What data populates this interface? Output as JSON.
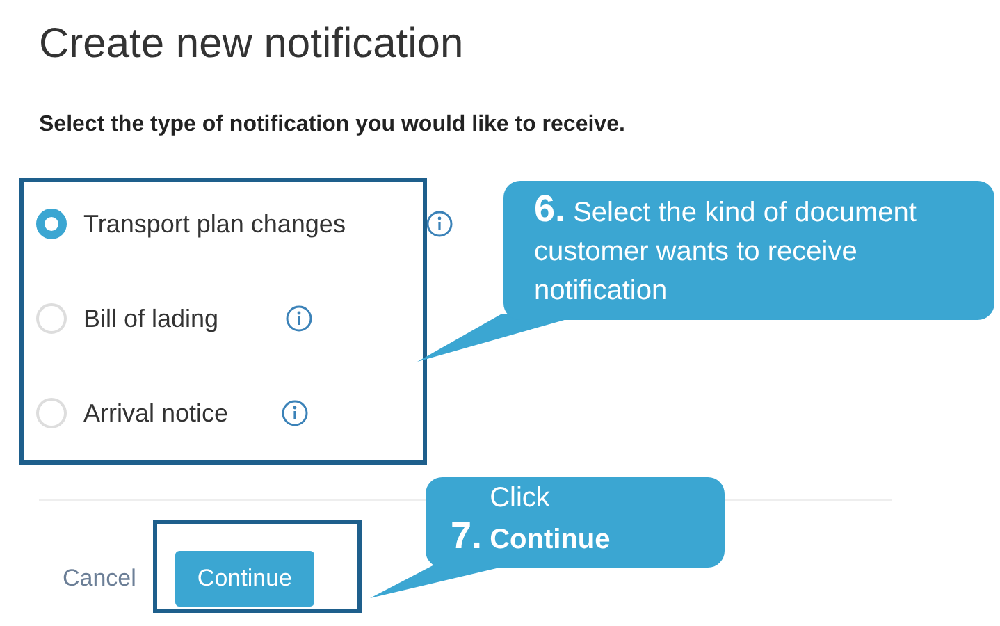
{
  "title": "Create new notification",
  "prompt": "Select the type of notification you would like to receive.",
  "options": [
    {
      "label": "Transport plan changes",
      "selected": true
    },
    {
      "label": "Bill of lading",
      "selected": false
    },
    {
      "label": "Arrival notice",
      "selected": false
    }
  ],
  "buttons": {
    "cancel": "Cancel",
    "continue": "Continue"
  },
  "callouts": [
    {
      "step": "6.",
      "text": "Select the kind of document customer wants to receive notification"
    },
    {
      "step": "7.",
      "text": "Click **Continue**"
    }
  ]
}
